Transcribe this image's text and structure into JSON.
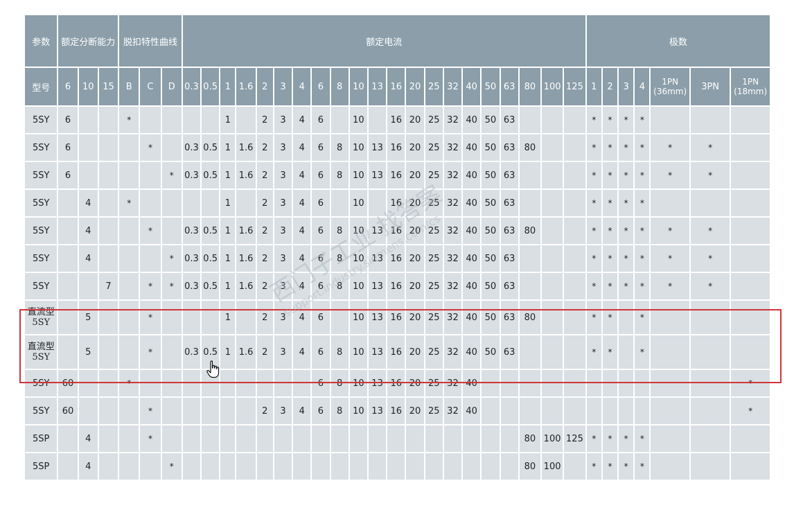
{
  "header_top": {
    "param": "参数",
    "breaking": "额定分断能力",
    "trip": "脱扣特性曲线",
    "current": "额定电流",
    "poles": "极数"
  },
  "header_sub": [
    "型号",
    "6",
    "10",
    "15",
    "B",
    "C",
    "D",
    "0.3",
    "0.5",
    "1",
    "1.6",
    "2",
    "3",
    "4",
    "6",
    "8",
    "10",
    "13",
    "16",
    "20",
    "25",
    "32",
    "40",
    "50",
    "63",
    "80",
    "100",
    "125",
    "1",
    "2",
    "3",
    "4",
    "1PN (36mm)",
    "3PN",
    "1PN (18mm)"
  ],
  "rows": [
    [
      "5SY",
      "6",
      "",
      "",
      "*",
      "",
      "",
      "",
      "",
      "1",
      "",
      "2",
      "3",
      "4",
      "6",
      "",
      "10",
      "",
      "16",
      "20",
      "25",
      "32",
      "40",
      "50",
      "63",
      "",
      "",
      "",
      "*",
      "*",
      "*",
      "*",
      "",
      "",
      ""
    ],
    [
      "5SY",
      "6",
      "",
      "",
      "",
      "*",
      "",
      "0.3",
      "0.5",
      "1",
      "1.6",
      "2",
      "3",
      "4",
      "6",
      "8",
      "10",
      "13",
      "16",
      "20",
      "25",
      "32",
      "40",
      "50",
      "63",
      "80",
      "",
      "",
      "*",
      "*",
      "*",
      "*",
      "*",
      "*",
      ""
    ],
    [
      "5SY",
      "6",
      "",
      "",
      "",
      "",
      "*",
      "0.3",
      "0.5",
      "1",
      "1.6",
      "2",
      "3",
      "4",
      "6",
      "8",
      "10",
      "13",
      "16",
      "20",
      "25",
      "32",
      "40",
      "50",
      "63",
      "",
      "",
      "",
      "*",
      "*",
      "*",
      "*",
      "*",
      "*",
      ""
    ],
    [
      "5SY",
      "",
      "4",
      "",
      "*",
      "",
      "",
      "",
      "",
      "1",
      "",
      "2",
      "3",
      "4",
      "6",
      "",
      "10",
      "",
      "16",
      "20",
      "25",
      "32",
      "40",
      "50",
      "63",
      "",
      "",
      "",
      "*",
      "*",
      "*",
      "*",
      "",
      "",
      ""
    ],
    [
      "5SY",
      "",
      "4",
      "",
      "",
      "*",
      "",
      "0.3",
      "0.5",
      "1",
      "1.6",
      "2",
      "3",
      "4",
      "6",
      "8",
      "10",
      "13",
      "16",
      "20",
      "25",
      "32",
      "40",
      "50",
      "63",
      "80",
      "",
      "",
      "*",
      "*",
      "*",
      "*",
      "*",
      "*",
      ""
    ],
    [
      "5SY",
      "",
      "4",
      "",
      "",
      "",
      "*",
      "0.3",
      "0.5",
      "1",
      "1.6",
      "2",
      "3",
      "4",
      "6",
      "8",
      "10",
      "13",
      "16",
      "20",
      "25",
      "32",
      "40",
      "50",
      "63",
      "",
      "",
      "",
      "*",
      "*",
      "*",
      "*",
      "*",
      "*",
      ""
    ],
    [
      "5SY",
      "",
      "",
      "7",
      "",
      "*",
      "*",
      "0.3",
      "0.5",
      "1",
      "1.6",
      "2",
      "3",
      "4",
      "6",
      "8",
      "10",
      "13",
      "16",
      "20",
      "25",
      "32",
      "40",
      "50",
      "63",
      "",
      "",
      "",
      "*",
      "*",
      "*",
      "*",
      "*",
      "*",
      ""
    ],
    [
      "直流型 5SY",
      "",
      "5",
      "",
      "",
      "*",
      "",
      "",
      "",
      "1",
      "",
      "2",
      "3",
      "4",
      "6",
      "",
      "10",
      "13",
      "16",
      "20",
      "25",
      "32",
      "40",
      "50",
      "63",
      "80",
      "",
      "",
      "*",
      "*",
      "",
      "*",
      "",
      "",
      ""
    ],
    [
      "直流型 5SY",
      "",
      "5",
      "",
      "",
      "*",
      "",
      "0.3",
      "0.5",
      "1",
      "1.6",
      "2",
      "3",
      "4",
      "6",
      "8",
      "10",
      "13",
      "16",
      "20",
      "25",
      "32",
      "40",
      "50",
      "63",
      "",
      "",
      "",
      "*",
      "*",
      "",
      "*",
      "",
      "",
      ""
    ],
    [
      "5SY",
      "60",
      "",
      "",
      "*",
      "",
      "",
      "",
      "",
      "",
      "",
      "",
      "",
      "",
      "6",
      "8",
      "10",
      "13",
      "16",
      "20",
      "25",
      "32",
      "40",
      "",
      "",
      "",
      "",
      "",
      "",
      "",
      "",
      "",
      "",
      "",
      "*"
    ],
    [
      "5SY",
      "60",
      "",
      "",
      "",
      "*",
      "",
      "",
      "",
      "",
      "",
      "2",
      "3",
      "4",
      "6",
      "8",
      "10",
      "13",
      "16",
      "20",
      "25",
      "32",
      "40",
      "",
      "",
      "",
      "",
      "",
      "",
      "",
      "",
      "",
      "",
      "",
      "*"
    ],
    [
      "5SP",
      "",
      "4",
      "",
      "",
      "*",
      "",
      "",
      "",
      "",
      "",
      "",
      "",
      "",
      "",
      "",
      "",
      "",
      "",
      "",
      "",
      "",
      "",
      "",
      "",
      "80",
      "100",
      "125",
      "*",
      "*",
      "*",
      "*",
      "",
      "",
      ""
    ],
    [
      "5SP",
      "",
      "4",
      "",
      "",
      "",
      "*",
      "",
      "",
      "",
      "",
      "",
      "",
      "",
      "",
      "",
      "",
      "",
      "",
      "",
      "",
      "",
      "",
      "",
      "",
      "80",
      "100",
      "",
      "*",
      "*",
      "*",
      "*",
      "",
      "",
      ""
    ]
  ],
  "watermark": {
    "text": "西门子工业 找答案",
    "url": "support.industry.siemens.com/cs"
  }
}
